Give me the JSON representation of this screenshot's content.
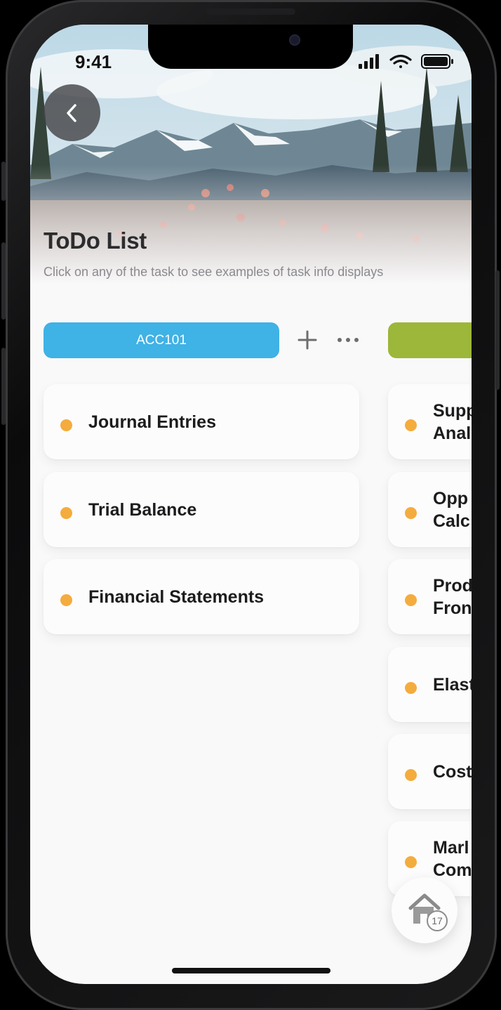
{
  "status_bar": {
    "time": "9:41",
    "icons": [
      "signal-icon",
      "wifi-icon",
      "battery-icon"
    ]
  },
  "header": {
    "back_icon": "chevron-left-icon",
    "title": "ToDo List",
    "subtitle": "Click on any of the task to see examples of task info displays"
  },
  "lists": [
    {
      "label": "ACC101",
      "color": "#3fb2e6",
      "tasks": [
        "Journal Entries",
        "Trial Balance",
        "Financial Statements"
      ]
    },
    {
      "label": "",
      "color": "#9cb73a",
      "tasks": [
        [
          "Supp",
          "Anal"
        ],
        [
          "Opp",
          "Calc"
        ],
        [
          "Prod",
          "Fron"
        ],
        [
          "Elast"
        ],
        [
          "Cost"
        ],
        [
          "Marl",
          "Com"
        ]
      ]
    }
  ],
  "list_actions": {
    "add_icon": "plus-icon",
    "more_icon": "ellipsis-icon"
  },
  "task_dot_color": "#f4ac3e",
  "home_button": {
    "icon": "home-icon",
    "badge": "17"
  }
}
